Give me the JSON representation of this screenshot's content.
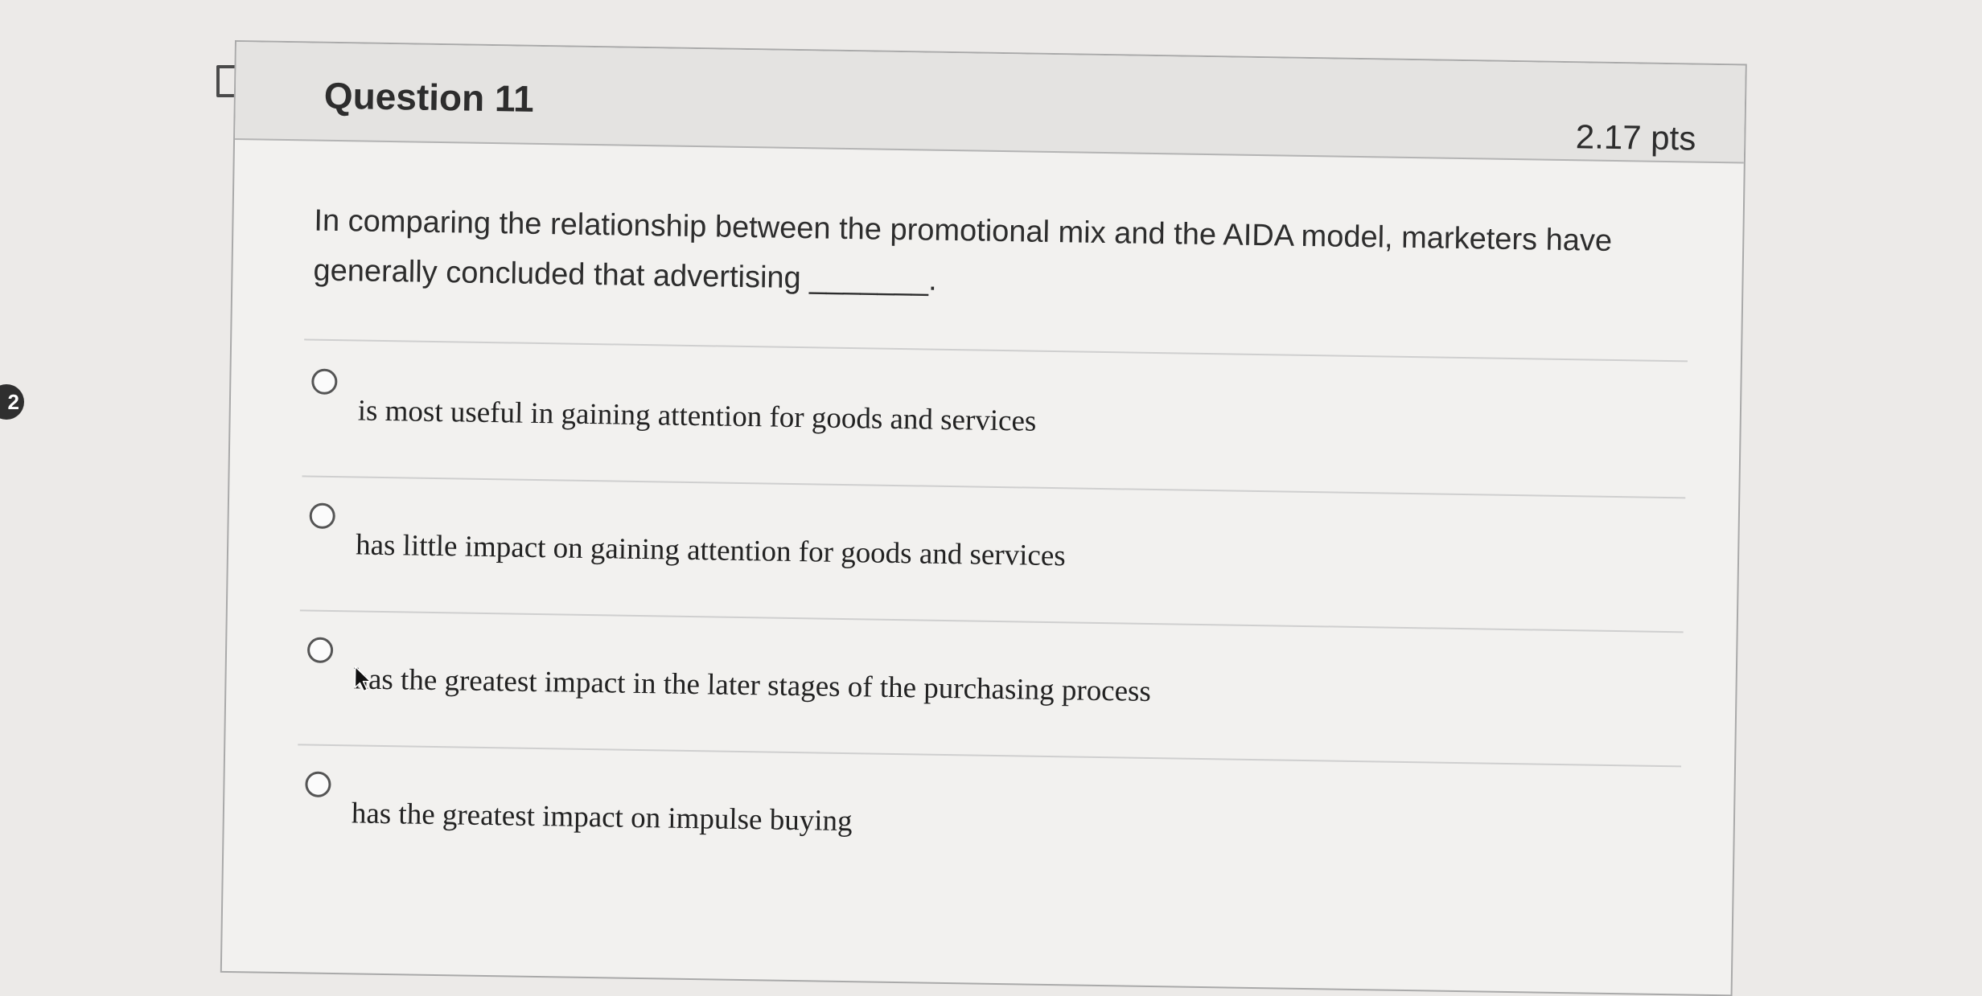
{
  "question": {
    "title": "Question 11",
    "points": "2.17 pts",
    "text": "In comparing the relationship between the promotional mix and the AIDA model, marketers have generally concluded that advertising _______."
  },
  "side_badge": "2",
  "answers": [
    {
      "label": "is most useful in gaining attention for goods and services",
      "selected": false
    },
    {
      "label": "has little impact on gaining attention for goods and services",
      "selected": false
    },
    {
      "label": "has the greatest impact in the later stages of the purchasing process",
      "selected": false
    },
    {
      "label": "has the greatest impact on impulse buying",
      "selected": false
    }
  ],
  "icons": {
    "flag": "flag-icon",
    "cursor": "mouse-pointer-icon"
  },
  "colors": {
    "background": "#eceae8",
    "card": "#f2f1ef",
    "header": "#e4e3e1",
    "text": "#2d2d2d",
    "border": "#a9a9a9"
  }
}
